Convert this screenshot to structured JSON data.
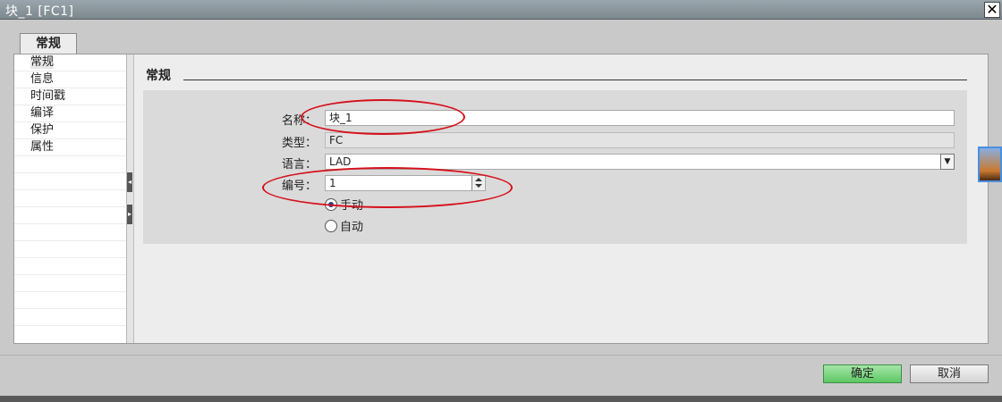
{
  "window": {
    "title": "块_1 [FC1]",
    "close_glyph": "✕"
  },
  "tabs": [
    {
      "label": "常规"
    }
  ],
  "sidebar": {
    "items": [
      {
        "label": "常规",
        "selected": true
      },
      {
        "label": "信息"
      },
      {
        "label": "时间戳"
      },
      {
        "label": "编译"
      },
      {
        "label": "保护"
      },
      {
        "label": "属性"
      }
    ]
  },
  "section": {
    "title": "常规",
    "fields": {
      "name": {
        "label": "名称：",
        "value": "块_1"
      },
      "type": {
        "label": "类型：",
        "value": "FC"
      },
      "language": {
        "label": "语言：",
        "value": "LAD"
      },
      "number": {
        "label": "编号：",
        "value": "1"
      }
    },
    "numbering": {
      "manual": {
        "label": "手动",
        "selected": true
      },
      "auto": {
        "label": "自动",
        "selected": false
      }
    }
  },
  "buttons": {
    "ok": "确定",
    "cancel": "取消"
  },
  "colors": {
    "highlight_ellipse": "#d6101a",
    "ok_button": "#5cc763"
  },
  "icons": {
    "close": "close-icon",
    "dropdown": "chevron-down-icon",
    "splitter_left": "chevron-left-icon",
    "splitter_right": "chevron-right-icon"
  }
}
